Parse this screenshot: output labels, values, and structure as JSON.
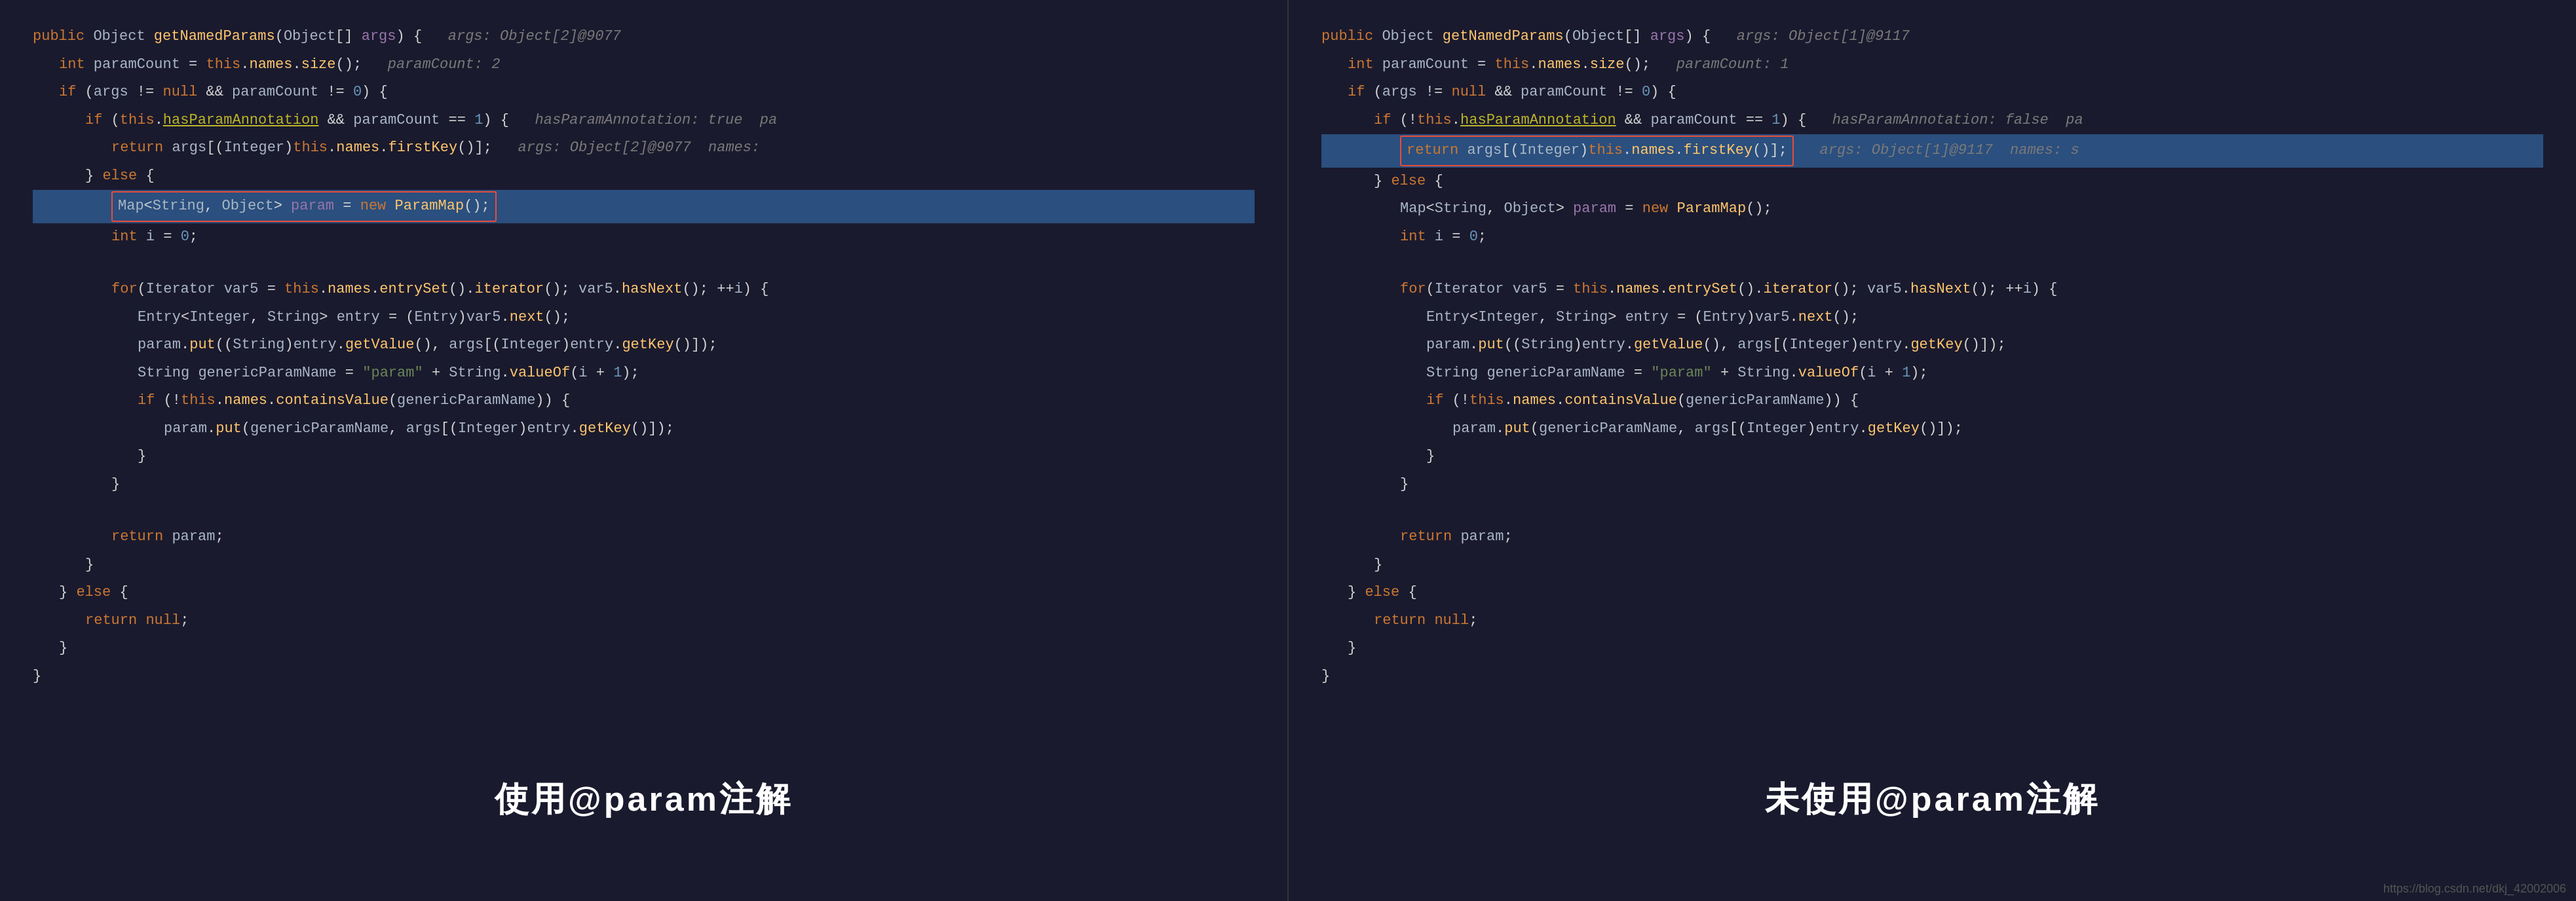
{
  "panels": {
    "left": {
      "label": "使用@param注解",
      "lines": [
        {
          "type": "normal",
          "content": "public Object getNamedParams(Object[] args) {",
          "comment": "args: Object[2]@9077"
        },
        {
          "type": "indent1",
          "content": "int paramCount = this.names.size();",
          "comment": "paramCount: 2"
        },
        {
          "type": "indent1",
          "content": "if (args != null && paramCount != 0) {"
        },
        {
          "type": "indent2",
          "content": "if (this.hasParamAnnotation && paramCount == 1) {",
          "comment": "hasParamAnnotation: true pa"
        },
        {
          "type": "indent3",
          "highlight": false,
          "content": "return args[(Integer)this.names.firstKey()];",
          "comment": "args: Object[2]@9077  names:"
        },
        {
          "type": "indent2",
          "content": "} else {"
        },
        {
          "type": "indent3",
          "highlight": true,
          "boxed": true,
          "content": "Map<String, Object> param = new ParamMap();"
        },
        {
          "type": "indent3",
          "content": "int i = 0;"
        },
        {
          "type": "empty"
        },
        {
          "type": "indent3",
          "content": "for(Iterator var5 = this.names.entrySet().iterator(); var5.hasNext(); ++i) {"
        },
        {
          "type": "indent4",
          "content": "Entry<Integer, String> entry = (Entry)var5.next();"
        },
        {
          "type": "indent4",
          "content": "param.put((String)entry.getValue(), args[(Integer)entry.getKey()]);"
        },
        {
          "type": "indent4",
          "content": "String genericParamName = \"param\" + String.valueOf(i + 1);"
        },
        {
          "type": "indent4",
          "content": "if (!this.names.containsValue(genericParamName)) {"
        },
        {
          "type": "indent5",
          "content": "param.put(genericParamName, args[(Integer)entry.getKey()]);"
        },
        {
          "type": "indent4",
          "content": "}"
        },
        {
          "type": "indent3",
          "content": "}"
        },
        {
          "type": "empty"
        },
        {
          "type": "indent3",
          "content": "return param;"
        },
        {
          "type": "indent2",
          "content": "}"
        },
        {
          "type": "indent1",
          "content": "} else {"
        },
        {
          "type": "indent2",
          "content": "return null;"
        },
        {
          "type": "indent1",
          "content": "}"
        },
        {
          "type": "normal",
          "content": "}"
        }
      ]
    },
    "right": {
      "label": "未使用@param注解",
      "lines": [
        {
          "type": "normal",
          "content": "public Object getNamedParams(Object[] args) {",
          "comment": "args: Object[1]@9117"
        },
        {
          "type": "indent1",
          "content": "int paramCount = this.names.size();",
          "comment": "paramCount: 1"
        },
        {
          "type": "indent1",
          "content": "if (args != null && paramCount != 0) {"
        },
        {
          "type": "indent2",
          "content": "if (!this.hasParamAnnotation && paramCount == 1) {",
          "comment": "hasParamAnnotation: false pa"
        },
        {
          "type": "indent3",
          "highlight": true,
          "boxed": true,
          "content": "return args[(Integer)this.names.firstKey()];",
          "comment": "args: Object[1]@9117  names: s"
        },
        {
          "type": "indent2",
          "content": "} else {"
        },
        {
          "type": "indent3",
          "highlight": false,
          "content": "Map<String, Object> param = new ParamMap();"
        },
        {
          "type": "indent3",
          "content": "int i = 0;"
        },
        {
          "type": "empty"
        },
        {
          "type": "indent3",
          "content": "for(Iterator var5 = this.names.entrySet().iterator(); var5.hasNext(); ++i) {"
        },
        {
          "type": "indent4",
          "content": "Entry<Integer, String> entry = (Entry)var5.next();"
        },
        {
          "type": "indent4",
          "content": "param.put((String)entry.getValue(), args[(Integer)entry.getKey()]);"
        },
        {
          "type": "indent4",
          "content": "String genericParamName = \"param\" + String.valueOf(i + 1);"
        },
        {
          "type": "indent4",
          "content": "if (!this.names.containsValue(genericParamName)) {"
        },
        {
          "type": "indent5",
          "content": "param.put(genericParamName, args[(Integer)entry.getKey()]);"
        },
        {
          "type": "indent4",
          "content": "}"
        },
        {
          "type": "indent3",
          "content": "}"
        },
        {
          "type": "empty"
        },
        {
          "type": "indent3",
          "content": "return param;"
        },
        {
          "type": "indent2",
          "content": "}"
        },
        {
          "type": "indent1",
          "content": "} else {"
        },
        {
          "type": "indent2",
          "content": "return null;"
        },
        {
          "type": "indent1",
          "content": "}"
        },
        {
          "type": "normal",
          "content": "}"
        }
      ]
    }
  },
  "watermark": "https://blog.csdn.net/dkj_42002006"
}
